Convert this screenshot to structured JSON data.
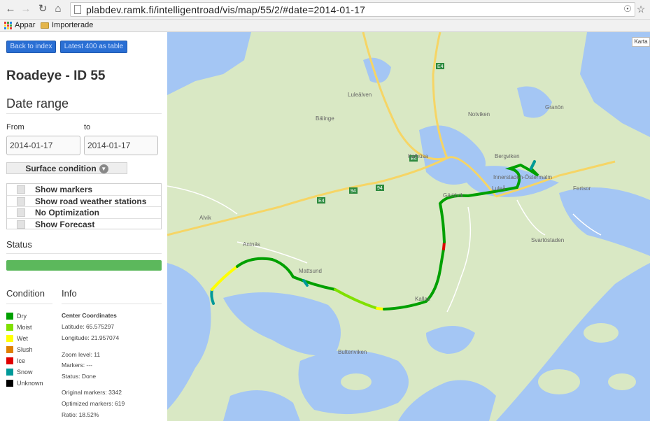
{
  "browser": {
    "url": "plabdev.ramk.fi/intelligentroad/vis/map/55/2/#date=2014-01-17",
    "bookmarks": [
      "Appar",
      "Importerade"
    ]
  },
  "sidebar": {
    "back_button": "Back to index",
    "latest_button": "Latest 400 as table",
    "title": "Roadeye - ID 55",
    "date_range_heading": "Date range",
    "from_label": "From",
    "to_label": "to",
    "from_value": "2014-01-17",
    "to_value": "2014-01-17",
    "surface_select": "Surface condition",
    "options": [
      {
        "label": "Show markers"
      },
      {
        "label": "Show road weather stations"
      },
      {
        "label": "No Optimization"
      },
      {
        "label": "Show Forecast"
      }
    ],
    "status_heading": "Status",
    "status_progress": 1.0,
    "condition_heading": "Condition",
    "info_heading": "Info",
    "legend": [
      {
        "label": "Dry",
        "color": "#00a000"
      },
      {
        "label": "Moist",
        "color": "#80e000"
      },
      {
        "label": "Wet",
        "color": "#ffff00"
      },
      {
        "label": "Slush",
        "color": "#e08000"
      },
      {
        "label": "Ice",
        "color": "#e00000"
      },
      {
        "label": "Snow",
        "color": "#009999"
      },
      {
        "label": "Unknown",
        "color": "#000000"
      }
    ],
    "info": {
      "center_title": "Center Coordinates",
      "latitude": "Latitude: 65.575297",
      "longitude": "Longitude: 21.957074",
      "zoom": "Zoom level: 11",
      "markers": "Markers: ---",
      "status": "Status: Done",
      "original": "Original markers: 3342",
      "optimized": "Optimized markers: 619",
      "ratio": "Ratio: 18.52%"
    }
  },
  "map": {
    "type_button": "Karta",
    "labels": [
      "Luleälven",
      "Bälinge",
      "Alvik",
      "Antnäs",
      "Mattsund",
      "Kallax",
      "Luleå",
      "Innerstaden-Östermalm",
      "Bergviken",
      "Fertsor",
      "Svartöstaden",
      "Kalhüsa",
      "Gäddvik",
      "Bultenviken",
      "Notviken",
      "Granön"
    ],
    "road_labels": [
      "E4",
      "94",
      "E4",
      "94",
      "E4"
    ],
    "colors": {
      "water": "#a4c6f4",
      "land": "#d9e8c4",
      "road": "#f6d565"
    }
  }
}
